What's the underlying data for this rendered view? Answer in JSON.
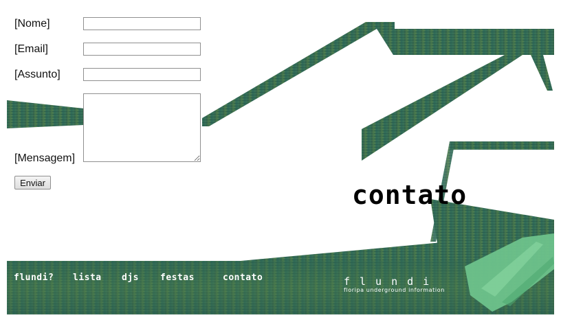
{
  "form": {
    "name_label": "[Nome]",
    "email_label": "[Email]",
    "subject_label": "[Assunto]",
    "message_label": "[Mensagem]",
    "name_value": "",
    "email_value": "",
    "subject_value": "",
    "message_value": "",
    "submit_label": "Enviar"
  },
  "page": {
    "heading": "contato"
  },
  "nav": {
    "items": [
      {
        "label": "flundi?"
      },
      {
        "label": "lista"
      },
      {
        "label": "djs"
      },
      {
        "label": "festas"
      },
      {
        "label": "contato"
      }
    ]
  },
  "brand": {
    "name": "flundi",
    "tagline": "floripa underground information"
  },
  "colors": {
    "accent_green": "#2f6b52",
    "light_green": "#6fc48d",
    "text": "#111111",
    "background": "#ffffff"
  }
}
